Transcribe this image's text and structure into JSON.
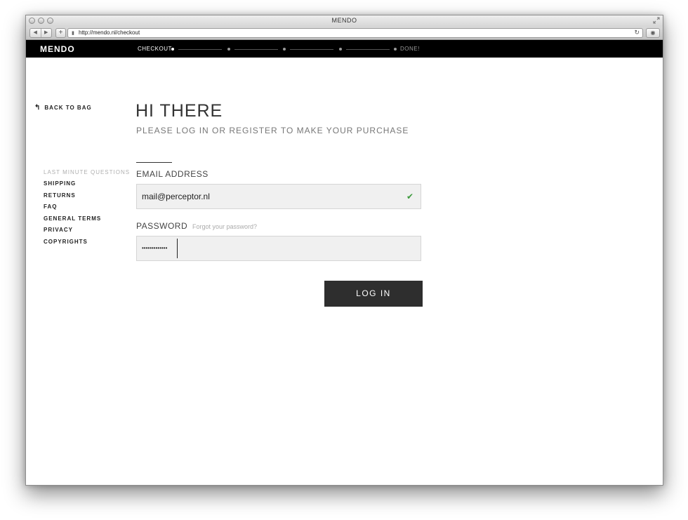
{
  "window": {
    "title": "MENDO"
  },
  "browser": {
    "url": "http://mendo.nl/checkout",
    "icons": {
      "back": "back-arrow-icon",
      "forward": "forward-arrow-icon",
      "add": "plus-icon",
      "reload": "reload-icon",
      "reader": "reader-icon",
      "lock": "page-icon"
    }
  },
  "site": {
    "logo": "MENDO",
    "steps": {
      "first": "CHECKOUT",
      "last": "DONE!"
    }
  },
  "sidebar": {
    "back_label": "BACK TO BAG",
    "heading": "LAST MINUTE QUESTIONS",
    "links": [
      "SHIPPING",
      "RETURNS",
      "FAQ",
      "GENERAL TERMS",
      "PRIVACY",
      "COPYRIGHTS"
    ]
  },
  "main": {
    "title": "HI THERE",
    "subtitle": "PLEASE LOG IN OR REGISTER TO MAKE YOUR PURCHASE",
    "email_label": "EMAIL ADDRESS",
    "email_value": "mail@perceptor.nl",
    "password_label": "PASSWORD",
    "forgot_link": "Forgot your password?",
    "password_mask": "•••••••••••••",
    "login_button": "LOG IN"
  },
  "colors": {
    "header_bg": "#000000",
    "button_bg": "#2e2e2e",
    "valid": "#3c9a3c",
    "field_bg": "#f0f0f0"
  }
}
